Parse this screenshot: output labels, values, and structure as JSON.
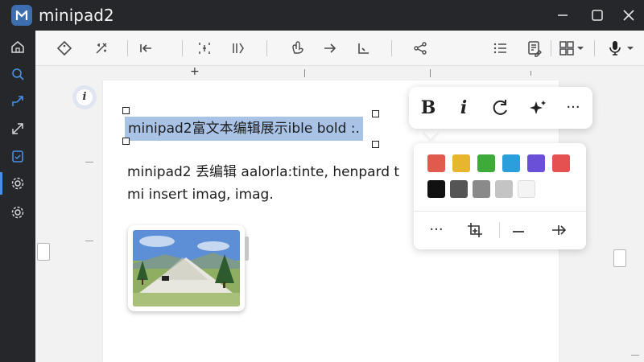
{
  "app": {
    "title": "minipad2",
    "logo_letter": "M"
  },
  "window_controls": [
    "minimize-icon",
    "maximize-icon",
    "close-icon"
  ],
  "sidebar": {
    "items": [
      {
        "icon": "home-icon",
        "active": false
      },
      {
        "icon": "search-icon",
        "active": false
      },
      {
        "icon": "share-icon",
        "active": false
      },
      {
        "icon": "resize-icon",
        "active": false
      },
      {
        "icon": "clipboard-icon",
        "active": false
      },
      {
        "icon": "gear-icon",
        "active": true
      },
      {
        "icon": "gear-icon",
        "active": false
      }
    ]
  },
  "toolbar": {
    "items": [
      "tag-icon",
      "wand-icon",
      "arrow-left-bar-icon",
      "frame-icon",
      "columns-icon",
      "hand-icon",
      "arrow-right-icon",
      "chart-icon",
      "share-node-icon",
      "list-icon",
      "document-edit-icon",
      "grid-icon",
      "chevron-down-icon",
      "microphone-icon",
      "chevron-down-icon"
    ]
  },
  "ruler": {
    "plus_label": "+"
  },
  "info_badge": "i",
  "document": {
    "selected_line": "minipad2富文本编辑展示ible bold :.",
    "line2": "minipad2 丢编辑 aalorla:tinte, henpard t",
    "line3": "mi insert imag, imag."
  },
  "format_popup": {
    "bold_label": "B",
    "italic_label": "i",
    "more_label": "···"
  },
  "color_popup": {
    "row1": [
      "#e05a4e",
      "#e8b62c",
      "#3daa3a",
      "#2b9fd9",
      "#6a4fd8",
      "#e55050"
    ],
    "row2": [
      "#111111",
      "#555555",
      "#8a8a8a",
      "#c4c4c4",
      "#f4f4f4"
    ],
    "more_label": "···"
  },
  "colors": {
    "titlebar": "#26272a",
    "selection": "#a8c3e6",
    "accent": "#4a90e2"
  }
}
